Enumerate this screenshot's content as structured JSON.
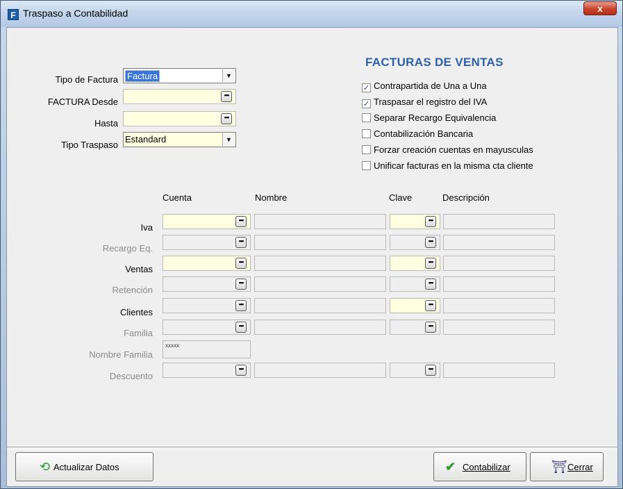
{
  "window": {
    "title": "Traspaso a Contabilidad",
    "app_icon_letter": "F",
    "close_label": "x"
  },
  "form": {
    "section_title": "FACTURAS DE VENTAS",
    "tipo_factura_label": "Tipo de Factura",
    "tipo_factura_value": "Factura",
    "factura_desde_label": "FACTURA Desde",
    "hasta_label": "Hasta",
    "tipo_traspaso_label": "Tipo Traspaso",
    "tipo_traspaso_value": "Estandard",
    "dots_glyph": "•••"
  },
  "options": [
    {
      "label": "Contrapartida de  Una a Una",
      "checked": true
    },
    {
      "label": "Traspasar el registro del IVA",
      "checked": true
    },
    {
      "label": "Separar Recargo Equivalencia",
      "checked": false
    },
    {
      "label": "Contabilización Bancaria",
      "checked": false
    },
    {
      "label": "Forzar creación cuentas en mayusculas",
      "checked": false
    },
    {
      "label": "Unificar facturas en la misma cta cliente",
      "checked": false
    }
  ],
  "grid": {
    "headers": {
      "cuenta": "Cuenta",
      "nombre": "Nombre",
      "clave": "Clave",
      "descripcion": "Descripción"
    },
    "rows": {
      "iva": "Iva",
      "recargo": "Recargo Eq.",
      "ventas": "Ventas",
      "retencion": "Retención",
      "clientes": "Clientes",
      "familia": "Familia",
      "nombre_familia": "Nombre Familia",
      "nombre_familia_value": "xxxxx",
      "descuento": "Descuento"
    }
  },
  "buttons": {
    "actualizar": "Actualizar Datos",
    "contabilizar": "Contabilizar",
    "cerrar": "Cerrar"
  },
  "colors": {
    "section_title": "#2d5fa8",
    "highlight_field": "#ffffe1",
    "selection": "#3875d7"
  }
}
